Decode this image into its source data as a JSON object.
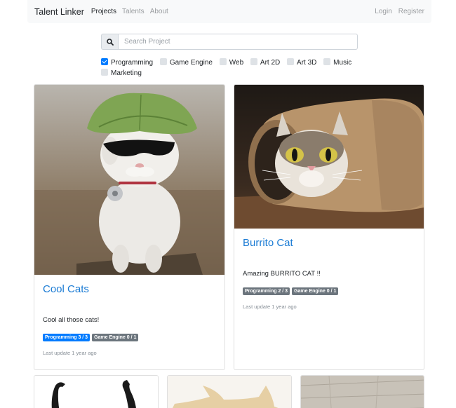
{
  "nav": {
    "brand": "Talent Linker",
    "links": [
      "Projects",
      "Talents",
      "About"
    ],
    "login": "Login",
    "register": "Register"
  },
  "search": {
    "placeholder": "Search Project"
  },
  "filters": [
    {
      "label": "Programming",
      "checked": true
    },
    {
      "label": "Game Engine",
      "checked": false
    },
    {
      "label": "Web",
      "checked": false
    },
    {
      "label": "Art 2D",
      "checked": false
    },
    {
      "label": "Art 3D",
      "checked": false
    },
    {
      "label": "Music",
      "checked": false
    },
    {
      "label": "Marketing",
      "checked": false
    }
  ],
  "projects": [
    {
      "title": "Cool Cats",
      "description": "Cool all those cats!",
      "badges": [
        "Programming 3 / 3",
        "Game Engine 0 / 1"
      ],
      "updated": "Last update 1 year ago"
    },
    {
      "title": "Burrito Cat",
      "description": "Amazing BURRITO CAT !!",
      "badges": [
        "Programming 2 / 3",
        "Game Engine 0 / 1"
      ],
      "updated": "Last update 1 year ago"
    }
  ]
}
